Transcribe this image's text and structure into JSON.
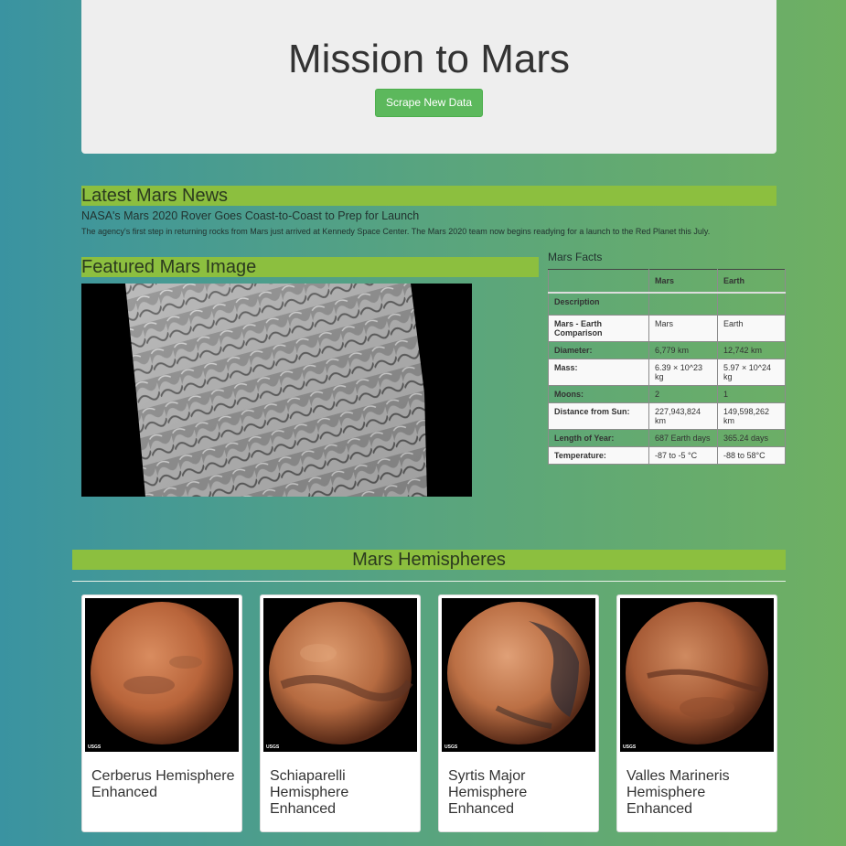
{
  "header": {
    "title": "Mission to Mars",
    "scrape_button": "Scrape New Data"
  },
  "news": {
    "heading": "Latest Mars News",
    "title": "NASA's Mars 2020 Rover Goes Coast-to-Coast to Prep for Launch",
    "paragraph": "The agency's first step in returning rocks from Mars just arrived at Kennedy Space Center. The Mars 2020 team now begins readying for a launch to the Red Planet this July."
  },
  "featured": {
    "heading": "Featured Mars Image"
  },
  "facts": {
    "caption": "Mars Facts",
    "columns": [
      "",
      "Mars",
      "Earth"
    ],
    "rows": [
      {
        "label": "Description",
        "mars": "",
        "earth": ""
      },
      {
        "label": "Mars - Earth Comparison",
        "mars": "Mars",
        "earth": "Earth"
      },
      {
        "label": "Diameter:",
        "mars": "6,779 km",
        "earth": "12,742 km"
      },
      {
        "label": "Mass:",
        "mars": "6.39 × 10^23 kg",
        "earth": "5.97 × 10^24 kg"
      },
      {
        "label": "Moons:",
        "mars": "2",
        "earth": "1"
      },
      {
        "label": "Distance from Sun:",
        "mars": "227,943,824 km",
        "earth": "149,598,262 km"
      },
      {
        "label": "Length of Year:",
        "mars": "687 Earth days",
        "earth": "365.24 days"
      },
      {
        "label": "Temperature:",
        "mars": "-87 to -5 °C",
        "earth": "-88 to 58°C"
      }
    ]
  },
  "hemispheres": {
    "heading": "Mars Hemispheres",
    "items": [
      {
        "title": "Cerberus Hemisphere Enhanced",
        "usgs": "USGS"
      },
      {
        "title": "Schiaparelli Hemisphere Enhanced",
        "usgs": "USGS"
      },
      {
        "title": "Syrtis Major Hemisphere Enhanced",
        "usgs": "USGS"
      },
      {
        "title": "Valles Marineris Hemisphere Enhanced",
        "usgs": "USGS"
      }
    ]
  },
  "colors": {
    "section_bar": "#8cbf3f",
    "button": "#5cb85c",
    "jumbotron": "#eeeeee"
  }
}
